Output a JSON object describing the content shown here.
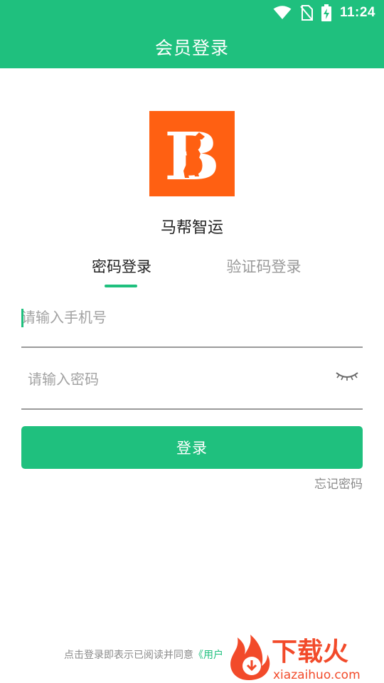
{
  "status_bar": {
    "time": "11:24",
    "icons": [
      "wifi-icon",
      "no-sim-icon",
      "battery-charging-icon"
    ]
  },
  "app_bar": {
    "title": "会员登录"
  },
  "brand": {
    "logo_icon": "horse-b-logo",
    "logo_color": "#ff6012",
    "name": "马帮智运"
  },
  "tabs": [
    {
      "label": "密码登录",
      "active": true
    },
    {
      "label": "验证码登录",
      "active": false
    }
  ],
  "form": {
    "phone_placeholder": "请输入手机号",
    "phone_value": "",
    "password_placeholder": "请输入密码",
    "password_value": "",
    "password_toggle_icon": "eye-closed-icon"
  },
  "actions": {
    "login_label": "登录",
    "forgot_label": "忘记密码"
  },
  "agreement": {
    "text": "点击登录即表示已阅读并同意",
    "link_text": "《用户"
  },
  "watermark": {
    "title": "下载火",
    "domain": "xiazaihuo.com"
  },
  "colors": {
    "primary": "#1fc07e",
    "text_dark": "#222222",
    "text_muted": "#999999"
  }
}
